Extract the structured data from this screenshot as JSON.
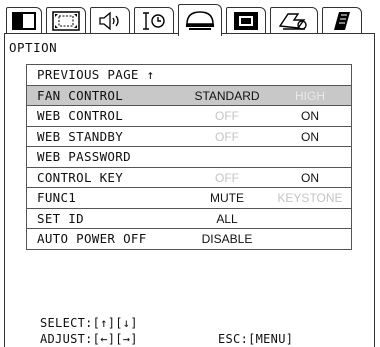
{
  "tabs": [
    {
      "icon": "display-tab-icon",
      "active": false
    },
    {
      "icon": "image-position-tab-icon",
      "active": false
    },
    {
      "icon": "audio-tab-icon",
      "active": false
    },
    {
      "icon": "input-tab-icon",
      "active": false
    },
    {
      "icon": "settings-tab-icon",
      "active": true
    },
    {
      "icon": "screen-tab-icon",
      "active": false
    },
    {
      "icon": "lamp-tab-icon",
      "active": false
    },
    {
      "icon": "memo-tab-icon",
      "active": false
    }
  ],
  "menu": {
    "title": "OPTION",
    "rows": [
      {
        "label": "PREVIOUS PAGE ↑",
        "opt1": "",
        "opt2": ""
      },
      {
        "label": "FAN CONTROL",
        "opt1": "STANDARD",
        "opt2": "HIGH"
      },
      {
        "label": "WEB CONTROL",
        "opt1": "OFF",
        "opt2": "ON"
      },
      {
        "label": "WEB STANDBY",
        "opt1": "OFF",
        "opt2": "ON"
      },
      {
        "label": "WEB PASSWORD",
        "opt1": "",
        "opt2": ""
      },
      {
        "label": "CONTROL KEY",
        "opt1": "OFF",
        "opt2": "ON"
      },
      {
        "label": "FUNC1",
        "opt1": "MUTE",
        "opt2": "KEYSTONE"
      },
      {
        "label": "SET ID",
        "opt1": "ALL",
        "opt2": ""
      },
      {
        "label": "AUTO POWER OFF",
        "opt1": "DISABLE",
        "opt2": ""
      }
    ]
  },
  "footer": {
    "select": "SELECT:[↑][↓]",
    "adjust": "ADJUST:[←][→]",
    "escape": "ESC:[MENU]"
  },
  "colors": {
    "selected_row": "#c8c8c8",
    "inactive_option": "#c4c4c4"
  }
}
